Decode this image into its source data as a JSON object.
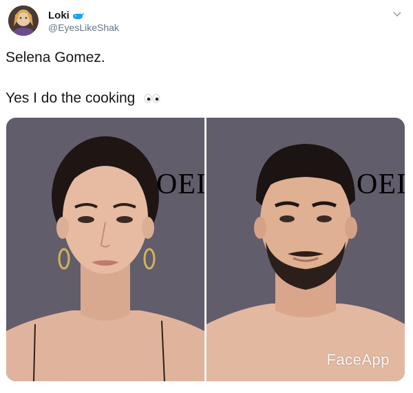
{
  "tweet": {
    "display_name": "Loki",
    "handle": "@EyesLikeShak",
    "text_line_1": "Selena Gomez.",
    "text_line_2": "Yes I do the cooking",
    "icons": {
      "verified_emoji": "whale-icon",
      "menu": "chevron-down-icon",
      "emoji": "eyes-icon"
    }
  },
  "media": {
    "left_background_text": "OEI",
    "right_background_text": "OEI",
    "watermark": "FaceApp"
  },
  "colors": {
    "text": "#14171a",
    "secondary": "#657786",
    "backdrop": "#5f5a67",
    "whale": "#1da1f2"
  }
}
